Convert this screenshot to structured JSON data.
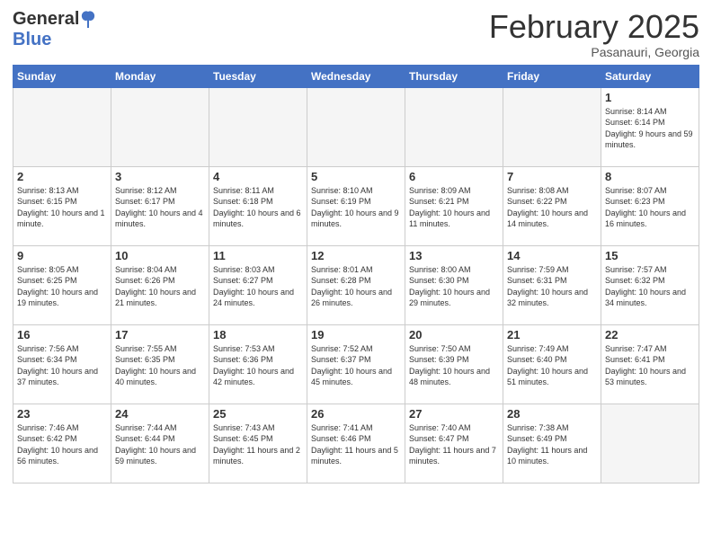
{
  "header": {
    "logo_general": "General",
    "logo_blue": "Blue",
    "month_title": "February 2025",
    "location": "Pasanauri, Georgia"
  },
  "days_of_week": [
    "Sunday",
    "Monday",
    "Tuesday",
    "Wednesday",
    "Thursday",
    "Friday",
    "Saturday"
  ],
  "weeks": [
    [
      {
        "num": "",
        "info": ""
      },
      {
        "num": "",
        "info": ""
      },
      {
        "num": "",
        "info": ""
      },
      {
        "num": "",
        "info": ""
      },
      {
        "num": "",
        "info": ""
      },
      {
        "num": "",
        "info": ""
      },
      {
        "num": "1",
        "info": "Sunrise: 8:14 AM\nSunset: 6:14 PM\nDaylight: 9 hours and 59 minutes."
      }
    ],
    [
      {
        "num": "2",
        "info": "Sunrise: 8:13 AM\nSunset: 6:15 PM\nDaylight: 10 hours and 1 minute."
      },
      {
        "num": "3",
        "info": "Sunrise: 8:12 AM\nSunset: 6:17 PM\nDaylight: 10 hours and 4 minutes."
      },
      {
        "num": "4",
        "info": "Sunrise: 8:11 AM\nSunset: 6:18 PM\nDaylight: 10 hours and 6 minutes."
      },
      {
        "num": "5",
        "info": "Sunrise: 8:10 AM\nSunset: 6:19 PM\nDaylight: 10 hours and 9 minutes."
      },
      {
        "num": "6",
        "info": "Sunrise: 8:09 AM\nSunset: 6:21 PM\nDaylight: 10 hours and 11 minutes."
      },
      {
        "num": "7",
        "info": "Sunrise: 8:08 AM\nSunset: 6:22 PM\nDaylight: 10 hours and 14 minutes."
      },
      {
        "num": "8",
        "info": "Sunrise: 8:07 AM\nSunset: 6:23 PM\nDaylight: 10 hours and 16 minutes."
      }
    ],
    [
      {
        "num": "9",
        "info": "Sunrise: 8:05 AM\nSunset: 6:25 PM\nDaylight: 10 hours and 19 minutes."
      },
      {
        "num": "10",
        "info": "Sunrise: 8:04 AM\nSunset: 6:26 PM\nDaylight: 10 hours and 21 minutes."
      },
      {
        "num": "11",
        "info": "Sunrise: 8:03 AM\nSunset: 6:27 PM\nDaylight: 10 hours and 24 minutes."
      },
      {
        "num": "12",
        "info": "Sunrise: 8:01 AM\nSunset: 6:28 PM\nDaylight: 10 hours and 26 minutes."
      },
      {
        "num": "13",
        "info": "Sunrise: 8:00 AM\nSunset: 6:30 PM\nDaylight: 10 hours and 29 minutes."
      },
      {
        "num": "14",
        "info": "Sunrise: 7:59 AM\nSunset: 6:31 PM\nDaylight: 10 hours and 32 minutes."
      },
      {
        "num": "15",
        "info": "Sunrise: 7:57 AM\nSunset: 6:32 PM\nDaylight: 10 hours and 34 minutes."
      }
    ],
    [
      {
        "num": "16",
        "info": "Sunrise: 7:56 AM\nSunset: 6:34 PM\nDaylight: 10 hours and 37 minutes."
      },
      {
        "num": "17",
        "info": "Sunrise: 7:55 AM\nSunset: 6:35 PM\nDaylight: 10 hours and 40 minutes."
      },
      {
        "num": "18",
        "info": "Sunrise: 7:53 AM\nSunset: 6:36 PM\nDaylight: 10 hours and 42 minutes."
      },
      {
        "num": "19",
        "info": "Sunrise: 7:52 AM\nSunset: 6:37 PM\nDaylight: 10 hours and 45 minutes."
      },
      {
        "num": "20",
        "info": "Sunrise: 7:50 AM\nSunset: 6:39 PM\nDaylight: 10 hours and 48 minutes."
      },
      {
        "num": "21",
        "info": "Sunrise: 7:49 AM\nSunset: 6:40 PM\nDaylight: 10 hours and 51 minutes."
      },
      {
        "num": "22",
        "info": "Sunrise: 7:47 AM\nSunset: 6:41 PM\nDaylight: 10 hours and 53 minutes."
      }
    ],
    [
      {
        "num": "23",
        "info": "Sunrise: 7:46 AM\nSunset: 6:42 PM\nDaylight: 10 hours and 56 minutes."
      },
      {
        "num": "24",
        "info": "Sunrise: 7:44 AM\nSunset: 6:44 PM\nDaylight: 10 hours and 59 minutes."
      },
      {
        "num": "25",
        "info": "Sunrise: 7:43 AM\nSunset: 6:45 PM\nDaylight: 11 hours and 2 minutes."
      },
      {
        "num": "26",
        "info": "Sunrise: 7:41 AM\nSunset: 6:46 PM\nDaylight: 11 hours and 5 minutes."
      },
      {
        "num": "27",
        "info": "Sunrise: 7:40 AM\nSunset: 6:47 PM\nDaylight: 11 hours and 7 minutes."
      },
      {
        "num": "28",
        "info": "Sunrise: 7:38 AM\nSunset: 6:49 PM\nDaylight: 11 hours and 10 minutes."
      },
      {
        "num": "",
        "info": ""
      }
    ]
  ]
}
